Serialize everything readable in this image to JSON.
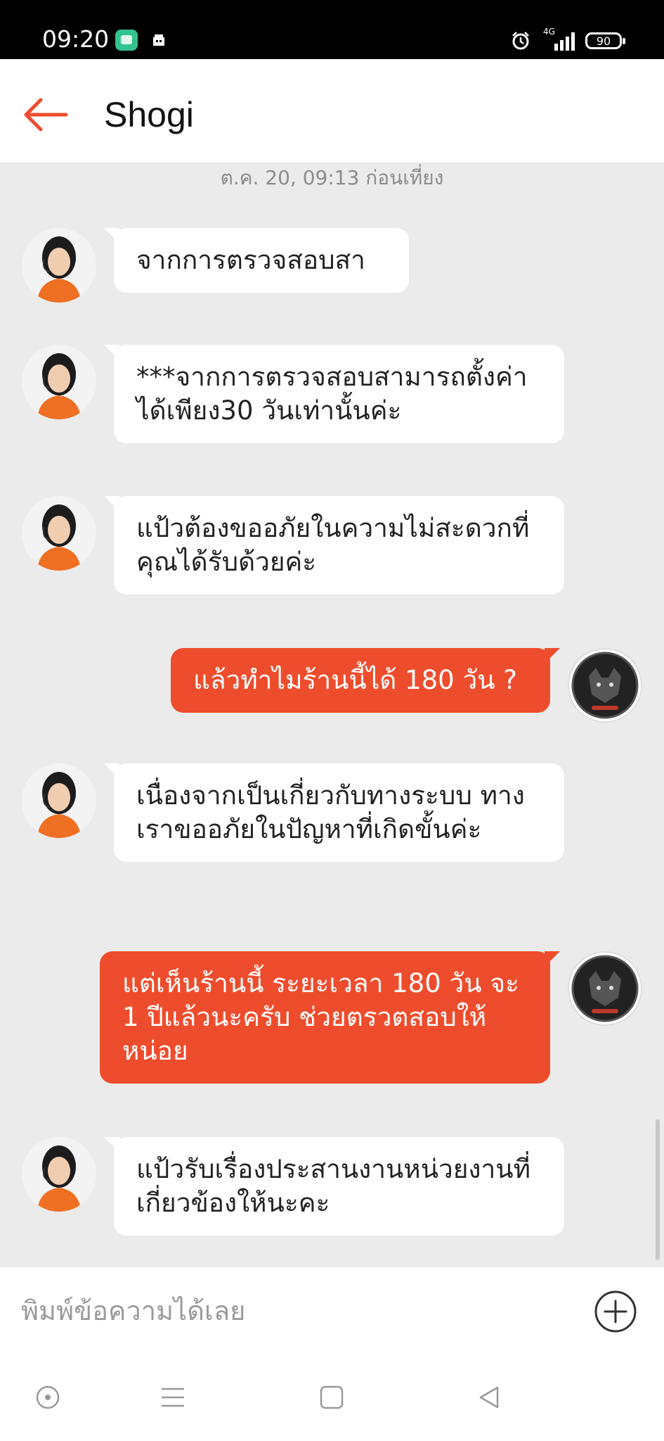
{
  "status_bar": {
    "time": "09:20",
    "network": "4G",
    "battery": "90",
    "icons": [
      "chat-app-icon",
      "shop-icon",
      "alarm-icon",
      "signal-icon",
      "battery-icon"
    ]
  },
  "header": {
    "title": "Shogi",
    "back_icon": "back-arrow-icon",
    "accent_color": "#ee4d2d"
  },
  "chat": {
    "timestamp": "ต.ค. 20, 09:13 ก่อนเที่ยง",
    "messages": [
      {
        "sender": "agent",
        "text": "จากการตรวจสอบสา"
      },
      {
        "sender": "agent",
        "text": "***จากการตรวจสอบสามารถตั้งค่าได้เพียง30 วันเท่านั้นค่ะ"
      },
      {
        "sender": "agent",
        "text": "แป้วต้องขออภัยในความไม่สะดวกที่คุณได้รับด้วยค่ะ"
      },
      {
        "sender": "user",
        "text": "แล้วทำไมร้านนี้ได้ 180 วัน ?"
      },
      {
        "sender": "agent",
        "text": "เนื่องจากเป็นเกี่ยวกับทางระบบ ทางเราขออภัยในปัญหาที่เกิดขั้นค่ะ"
      },
      {
        "sender": "user",
        "text": "แต่เห็นร้านนี้ ระยะเวลา 180 วัน จะ 1 ปีแล้วนะครับ ช่วยตรวตสอบให้หน่อย"
      },
      {
        "sender": "agent",
        "text": "แป้วรับเรื่องประสานงานหน่วยงานที่เกี่ยวข้องให้นะคะ"
      }
    ]
  },
  "input": {
    "placeholder": "พิมพ์ข้อความได้เลย",
    "value": "",
    "attach_icon": "plus-circle-icon"
  },
  "nav_bar": {
    "icons": [
      "assistant-icon",
      "menu-icon",
      "home-icon",
      "back-icon"
    ]
  }
}
